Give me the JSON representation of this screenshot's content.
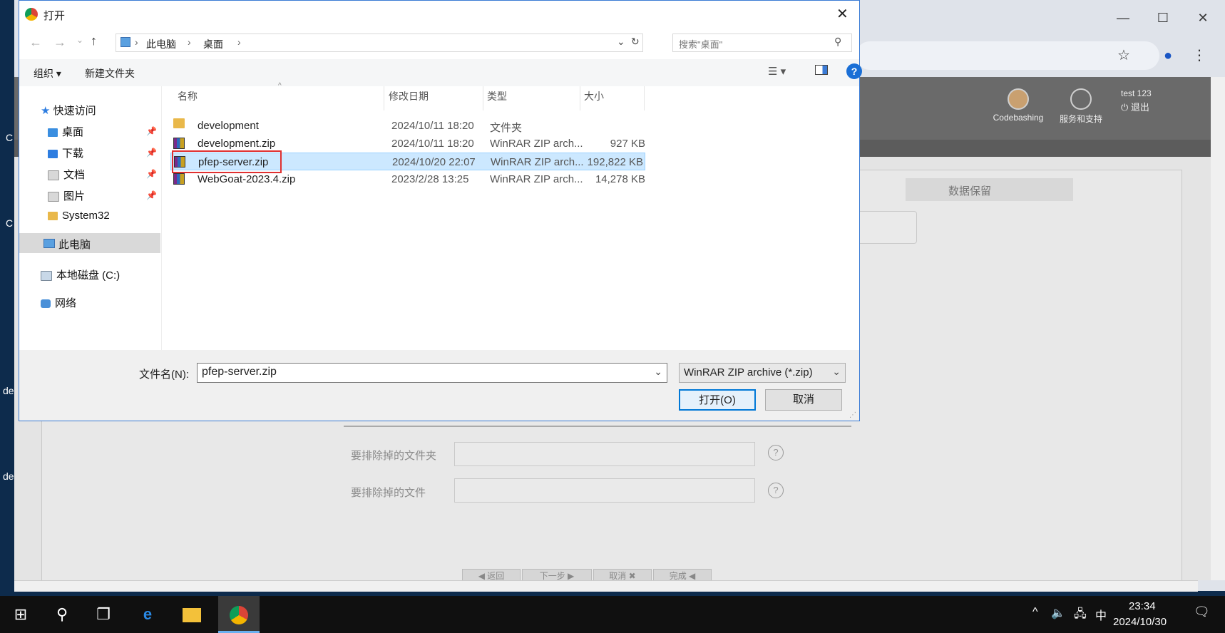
{
  "desktop": {
    "edge_glyphs": [
      "C",
      "C",
      "de",
      "de"
    ]
  },
  "browser": {
    "min_glyph": "—",
    "max_glyph": "☐",
    "close_glyph": "✕",
    "star_icon": "☆",
    "profile_icon": "●",
    "menu_icon": "⋮"
  },
  "webpage": {
    "user": "test 123",
    "logout": "退出",
    "codebashing": "Codebashing",
    "service": "服务和支持",
    "step_label": "数据保留",
    "exclude_folders_label": "要排除掉的文件夹",
    "exclude_files_label": "要排除掉的文件",
    "help_glyph": "?",
    "buttons": [
      "◀ 返回",
      "下一步 ▶",
      "取消 ✖",
      "完成 ◀"
    ]
  },
  "dialog": {
    "title": "打开",
    "breadcrumb": [
      "此电脑",
      "桌面"
    ],
    "search_placeholder": "搜索\"桌面\"",
    "organize": "组织 ▾",
    "new_folder": "新建文件夹",
    "help": "?",
    "nav": {
      "quick_access": "快速访问",
      "desktop": "桌面",
      "downloads": "下载",
      "documents": "文档",
      "pictures": "图片",
      "system32": "System32",
      "this_pc": "此电脑",
      "local_disk": "本地磁盘 (C:)",
      "network": "网络"
    },
    "columns": {
      "name": "名称",
      "date": "修改日期",
      "type": "类型",
      "size": "大小"
    },
    "files": [
      {
        "name": "development",
        "date": "2024/10/11 18:20",
        "type": "文件夹",
        "size": "",
        "kind": "folder"
      },
      {
        "name": "development.zip",
        "date": "2024/10/11 18:20",
        "type": "WinRAR ZIP arch...",
        "size": "927 KB",
        "kind": "zip"
      },
      {
        "name": "pfep-server.zip",
        "date": "2024/10/20 22:07",
        "type": "WinRAR ZIP arch...",
        "size": "192,822 KB",
        "kind": "zip",
        "selected": true
      },
      {
        "name": "WebGoat-2023.4.zip",
        "date": "2023/2/28 13:25",
        "type": "WinRAR ZIP arch...",
        "size": "14,278 KB",
        "kind": "zip"
      }
    ],
    "filename_label": "文件名(N):",
    "filename_value": "pfep-server.zip",
    "filetype_value": "WinRAR ZIP archive (*.zip)",
    "open_button": "打开(O)",
    "cancel_button": "取消"
  },
  "taskbar": {
    "time": "23:34",
    "date": "2024/10/30",
    "ime": "中"
  }
}
